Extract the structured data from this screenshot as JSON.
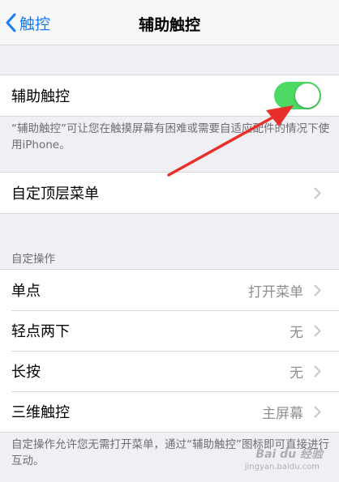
{
  "nav": {
    "back_label": "触控",
    "title": "辅助触控"
  },
  "assistive_touch": {
    "label": "辅助触控",
    "enabled": true,
    "toggle_color": "#4cd964",
    "note": "“辅助触控”可让您在触摸屏幕有困难或需要自适应配件的情况下使用iPhone。"
  },
  "top_menu": {
    "label": "自定顶层菜单"
  },
  "custom_actions": {
    "header": "自定操作",
    "rows": [
      {
        "label": "单点",
        "value": "打开菜单"
      },
      {
        "label": "轻点两下",
        "value": "无"
      },
      {
        "label": "长按",
        "value": "无"
      },
      {
        "label": "三维触控",
        "value": "主屏幕"
      }
    ],
    "note": "自定操作允许您无需打开菜单，通过“辅助触控”图标即可直接进行互动。"
  },
  "colors": {
    "accent": "#1a7cf6",
    "annotation_arrow": "#e8302a"
  },
  "watermark": {
    "logo": "Bai du 经验",
    "sub": "jingyan.baidu.com"
  }
}
